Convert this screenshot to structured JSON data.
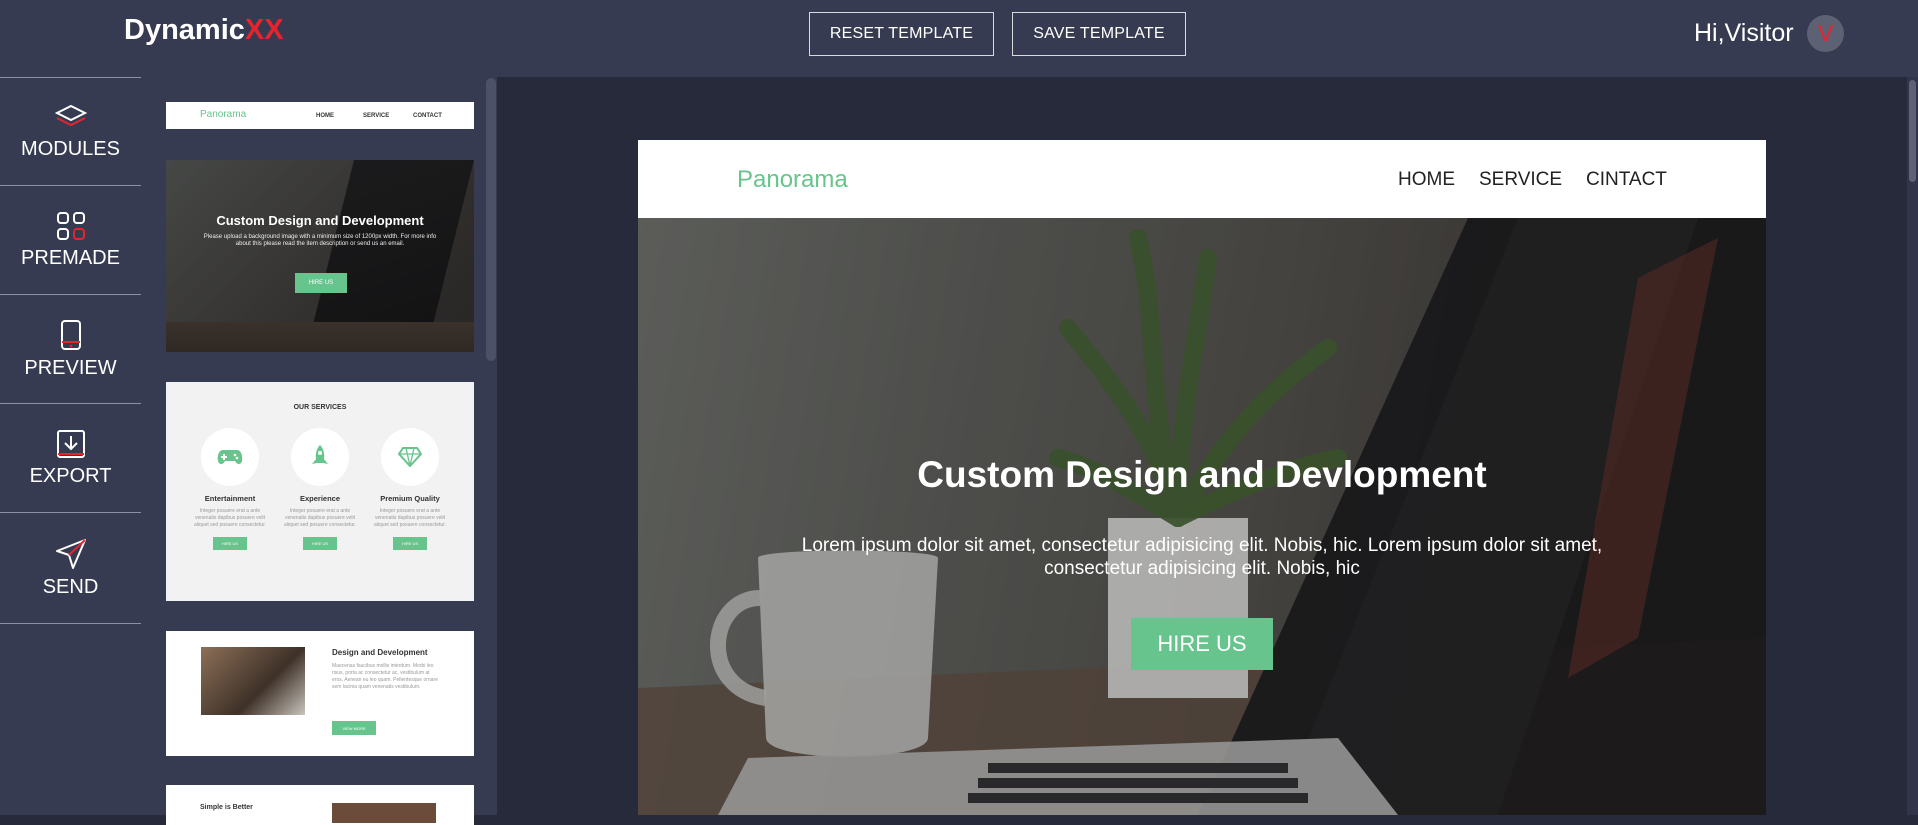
{
  "app": {
    "logo_main": "Dynamic",
    "logo_accent": "XX"
  },
  "toolbar": {
    "reset_label": "RESET TEMPLATE",
    "save_label": "SAVE TEMPLATE"
  },
  "user": {
    "greeting": "Hi,Visitor",
    "avatar_initial": "V"
  },
  "sidebar": {
    "items": [
      {
        "label": "MODULES",
        "icon": "layers-icon"
      },
      {
        "label": "PREMADE",
        "icon": "grid-icon"
      },
      {
        "label": "PREVIEW",
        "icon": "mobile-icon"
      },
      {
        "label": "EXPORT",
        "icon": "download-icon"
      },
      {
        "label": "SEND",
        "icon": "send-icon"
      }
    ]
  },
  "thumbnails": {
    "header": {
      "brand": "Panorama",
      "links": [
        "HOME",
        "SERVICE",
        "CONTACT"
      ]
    },
    "hero": {
      "title": "Custom Design and Development",
      "text": "Please upload a background image with a minimum size of 1200px width. For more info about this please read the item description or send us an email.",
      "button": "HIRE US"
    },
    "services": {
      "title": "OUR SERVICES",
      "items": [
        {
          "name": "Entertainment",
          "icon": "gamepad-icon",
          "text": "Integer posuere erat a ante venenatis dapibus posuere velit aliquet sed posuere consectetur.",
          "button": "HIRE US"
        },
        {
          "name": "Experience",
          "icon": "rocket-icon",
          "text": "Integer posuere erat a ante venenatis dapibus posuere velit aliquet sed posuere consectetur.",
          "button": "HIRE US"
        },
        {
          "name": "Premium Quality",
          "icon": "diamond-icon",
          "text": "Integer posuere erat a ante venenatis dapibus posuere velit aliquet sed posuere consectetur.",
          "button": "HIRE US"
        }
      ]
    },
    "feature": {
      "title": "Design and Development",
      "text": "Maecenas faucibus mollis interdum. Morbi leo risus, porta ac consectetur ac, vestibulum at eros. Aenean eu leo quam. Pellentesque ornare sem lacinia quam venenatis vestibulum.",
      "button": "VIEW MORE"
    },
    "simple": {
      "title": "Simple is Better"
    }
  },
  "preview": {
    "brand": "Panorama",
    "nav": [
      "HOME",
      "SERVICE",
      "CINTACT"
    ],
    "hero_title": "Custom Design and Devlopment",
    "hero_text": "Lorem ipsum dolor sit amet, consectetur adipisicing elit. Nobis, hic. Lorem ipsum dolor sit amet, consectetur adipisicing elit. Nobis, hic",
    "hero_button": "HIRE US"
  },
  "colors": {
    "accent_red": "#e8232e",
    "accent_green": "#66c48c",
    "panel_bg": "#373b52",
    "canvas_bg": "#272a3a"
  }
}
